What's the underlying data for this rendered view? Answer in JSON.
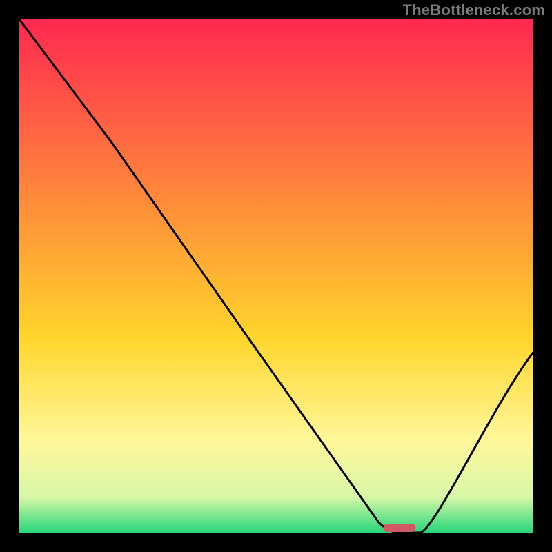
{
  "watermark": "TheBottleneck.com",
  "chart_data": {
    "type": "line",
    "title": "",
    "xlabel": "",
    "ylabel": "",
    "xlim": [
      0,
      100
    ],
    "ylim": [
      0,
      100
    ],
    "grid": false,
    "axes_visible": false,
    "series": [
      {
        "name": "bottleneck-curve",
        "color": "#000000",
        "x": [
          0,
          18,
          70,
          74,
          78,
          100
        ],
        "y": [
          100,
          76,
          2,
          0,
          0,
          35
        ]
      }
    ],
    "marker": {
      "name": "optimal-indicator",
      "x": 74,
      "y": 1,
      "color": "#cf5a63",
      "shape": "pill"
    },
    "background_gradient": {
      "top": "#ff2851",
      "mid1": "#ff8a3a",
      "mid2": "#ffd52b",
      "mid3": "#fff79a",
      "bottom": "#27d67a",
      "stops_pct": [
        0,
        35,
        62,
        82,
        100
      ]
    }
  }
}
